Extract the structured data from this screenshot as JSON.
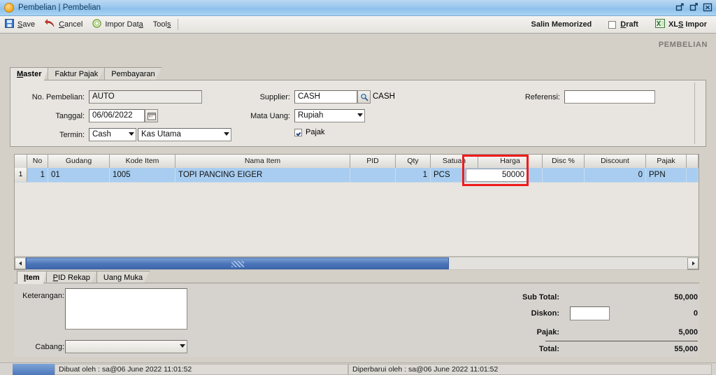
{
  "window": {
    "title": "Pembelian | Pembelian",
    "icon": "app-circle-icon",
    "controls": {
      "restore": "restore-down",
      "maximize": "maximize",
      "close": "close"
    }
  },
  "toolbar": {
    "save": "Save",
    "cancel": "Cancel",
    "impor_data": "Impor Data",
    "tools": "Tools",
    "salin_memorized": "Salin Memorized",
    "draft": "Draft",
    "draft_checked": false,
    "xls_impor": "XLS Impor"
  },
  "watermark": "PEMBELIAN",
  "tabs": [
    {
      "label": "Master",
      "active": true
    },
    {
      "label": "Faktur Pajak",
      "active": false
    },
    {
      "label": "Pembayaran",
      "active": false
    }
  ],
  "form": {
    "no_pembelian_label": "No. Pembelian:",
    "no_pembelian_value": "AUTO",
    "tanggal_label": "Tanggal:",
    "tanggal_value": "06/06/2022",
    "termin_label": "Termin:",
    "termin_value": "Cash",
    "termin_account_value": "Kas Utama",
    "supplier_label": "Supplier:",
    "supplier_value": "CASH",
    "supplier_name": "CASH",
    "mata_uang_label": "Mata Uang:",
    "mata_uang_value": "Rupiah",
    "pajak_label": "Pajak",
    "pajak_checked": true,
    "referensi_label": "Referensi:",
    "referensi_value": ""
  },
  "grid": {
    "columns": [
      "No",
      "Gudang",
      "Kode Item",
      "Nama Item",
      "PID",
      "Qty",
      "Satuan",
      "Harga",
      "Disc %",
      "Discount",
      "Pajak",
      ""
    ],
    "rows": [
      {
        "row_number": "1",
        "no": "1",
        "gudang": "01",
        "kode_item": "1005",
        "nama_item": "TOPI PANCING EIGER",
        "pid": "",
        "qty": "1",
        "satuan": "PCS",
        "harga": "50000",
        "disc_persen": "",
        "discount": "0",
        "pajak": "PPN",
        "extra": ""
      }
    ],
    "editing_cell": "harga",
    "highlight_color": "#ee1c1c"
  },
  "bottom_tabs": [
    {
      "label": "Item",
      "active": true
    },
    {
      "label": "PID Rekap",
      "active": false
    },
    {
      "label": "Uang Muka",
      "active": false
    }
  ],
  "bottom": {
    "keterangan_label": "Keterangan:",
    "keterangan_value": "",
    "cabang_label": "Cabang:",
    "cabang_value": ""
  },
  "totals": {
    "sub_total_label": "Sub Total:",
    "sub_total_value": "50,000",
    "diskon_label": "Diskon:",
    "diskon_input_value": "",
    "diskon_value": "0",
    "pajak_label": "Pajak:",
    "pajak_value": "5,000",
    "total_label": "Total:",
    "total_value": "55,000"
  },
  "statusbar": {
    "created": "Dibuat oleh : sa@06 June 2022  11:01:52",
    "updated": "Diperbarui oleh : sa@06 June 2022  11:01:52"
  }
}
